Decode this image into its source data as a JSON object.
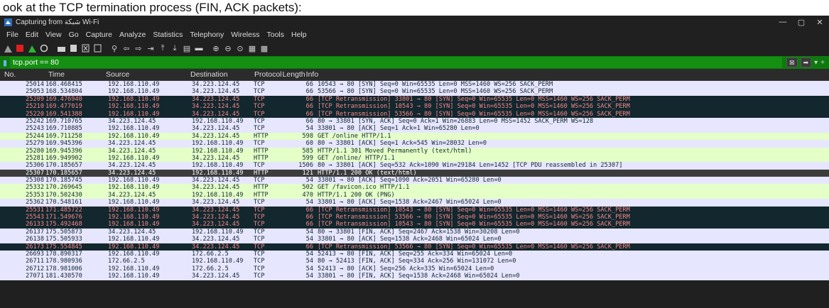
{
  "caption": "ook at the TCP termination process (FIN, ACK packets):",
  "window": {
    "title": "Capturing from شبكة Wi-Fi",
    "minimize": "—",
    "maximize": "▢",
    "close": "✕"
  },
  "menu": [
    "File",
    "Edit",
    "View",
    "Go",
    "Capture",
    "Analyze",
    "Statistics",
    "Telephony",
    "Wireless",
    "Tools",
    "Help"
  ],
  "toolbar_icons": [
    "shark-fin-icon",
    "stop-icon",
    "restart-icon",
    "options-icon",
    "open-icon",
    "save-icon",
    "close-file-icon",
    "reload-icon",
    "find-icon",
    "back-icon",
    "forward-icon",
    "goto-icon",
    "first-icon",
    "last-icon",
    "autoscroll-icon",
    "colorize-icon",
    "zoom-in-icon",
    "zoom-out-icon",
    "normal-size-icon",
    "resize-columns-icon"
  ],
  "filter": {
    "value": "tcp.port == 80"
  },
  "columns": [
    "No.",
    "Time",
    "Source",
    "Destination",
    "Protocol",
    "Length",
    "Info"
  ],
  "colors": {
    "filter_bg": "#0e7a0d",
    "retrans_fg": "#f78787",
    "retrans_bg": "#12272e",
    "http_bg": "#e4ffc7",
    "tcp_bg": "#e7e6ff"
  },
  "packets": [
    {
      "no": "25014",
      "time": "168.468415",
      "src": "192.168.110.49",
      "dst": "34.223.124.45",
      "proto": "TCP",
      "len": "66",
      "info": "10543 → 80 [SYN] Seq=0 Win=65535 Len=0 MSS=1460 WS=256 SACK_PERM",
      "style": "tcpg"
    },
    {
      "no": "25053",
      "time": "168.534804",
      "src": "192.168.110.49",
      "dst": "34.223.124.45",
      "proto": "TCP",
      "len": "66",
      "info": "53566 → 80 [SYN] Seq=0 Win=65535 Len=0 MSS=1460 WS=256 SACK_PERM",
      "style": "tcpg"
    },
    {
      "no": "25209",
      "time": "169.476940",
      "src": "192.168.110.49",
      "dst": "34.223.124.45",
      "proto": "TCP",
      "len": "66",
      "info": "[TCP Retransmission] 33801 → 80 [SYN] Seq=0 Win=65535 Len=0 MSS=1460 WS=256 SACK_PERM",
      "style": "retrans"
    },
    {
      "no": "25210",
      "time": "169.477019",
      "src": "192.168.110.49",
      "dst": "34.223.124.45",
      "proto": "TCP",
      "len": "66",
      "info": "[TCP Retransmission] 10543 → 80 [SYN] Seq=0 Win=65535 Len=0 MSS=1460 WS=256 SACK_PERM",
      "style": "retrans"
    },
    {
      "no": "25220",
      "time": "169.541388",
      "src": "192.168.110.49",
      "dst": "34.223.124.45",
      "proto": "TCP",
      "len": "66",
      "info": "[TCP Retransmission] 53566 → 80 [SYN] Seq=0 Win=65535 Len=0 MSS=1460 WS=256 SACK_PERM",
      "style": "retrans"
    },
    {
      "no": "25242",
      "time": "169.710765",
      "src": "34.223.124.45",
      "dst": "192.168.110.49",
      "proto": "TCP",
      "len": "66",
      "info": "80 → 33801 [SYN, ACK] Seq=0 Ack=1 Win=26883 Len=0 MSS=1452 SACK_PERM WS=128",
      "style": "tcpg"
    },
    {
      "no": "25243",
      "time": "169.710885",
      "src": "192.168.110.49",
      "dst": "34.223.124.45",
      "proto": "TCP",
      "len": "54",
      "info": "33801 → 80 [ACK] Seq=1 Ack=1 Win=65280 Len=0",
      "style": "tcpg"
    },
    {
      "no": "25244",
      "time": "169.711258",
      "src": "192.168.110.49",
      "dst": "34.223.124.45",
      "proto": "HTTP",
      "len": "598",
      "info": "GET /online HTTP/1.1",
      "style": "http"
    },
    {
      "no": "25279",
      "time": "169.945396",
      "src": "34.223.124.45",
      "dst": "192.168.110.49",
      "proto": "TCP",
      "len": "60",
      "info": "80 → 33801 [ACK] Seq=1 Ack=545 Win=28032 Len=0",
      "style": "tcpg"
    },
    {
      "no": "25280",
      "time": "169.945396",
      "src": "34.223.124.45",
      "dst": "192.168.110.49",
      "proto": "HTTP",
      "len": "585",
      "info": "HTTP/1.1 301 Moved Permanently  (text/html)",
      "style": "http"
    },
    {
      "no": "25281",
      "time": "169.949902",
      "src": "192.168.110.49",
      "dst": "34.223.124.45",
      "proto": "HTTP",
      "len": "599",
      "info": "GET /online/ HTTP/1.1",
      "style": "http"
    },
    {
      "no": "25306",
      "time": "170.185657",
      "src": "34.223.124.45",
      "dst": "192.168.110.49",
      "proto": "TCP",
      "len": "1506",
      "info": "80 → 33801 [ACK] Seq=532 Ack=1090 Win=29184 Len=1452 [TCP PDU reassembled in 25307]",
      "style": "tcpg"
    },
    {
      "no": "25307",
      "time": "170.185657",
      "src": "34.223.124.45",
      "dst": "192.168.110.49",
      "proto": "HTTP",
      "len": "121",
      "info": "HTTP/1.1 200 OK  (text/html)",
      "style": "sel"
    },
    {
      "no": "25308",
      "time": "170.185745",
      "src": "192.168.110.49",
      "dst": "34.223.124.45",
      "proto": "TCP",
      "len": "54",
      "info": "33801 → 80 [ACK] Seq=1090 Ack=2051 Win=65280 Len=0",
      "style": "tcpg"
    },
    {
      "no": "25332",
      "time": "170.269645",
      "src": "192.168.110.49",
      "dst": "34.223.124.45",
      "proto": "HTTP",
      "len": "502",
      "info": "GET /favicon.ico HTTP/1.1",
      "style": "http"
    },
    {
      "no": "25353",
      "time": "170.502430",
      "src": "34.223.124.45",
      "dst": "192.168.110.49",
      "proto": "HTTP",
      "len": "470",
      "info": "HTTP/1.1 200 OK  (PNG)",
      "style": "http"
    },
    {
      "no": "25362",
      "time": "170.548161",
      "src": "192.168.110.49",
      "dst": "34.223.124.45",
      "proto": "TCP",
      "len": "54",
      "info": "33801 → 80 [ACK] Seq=1538 Ack=2467 Win=65024 Len=0",
      "style": "tcpg"
    },
    {
      "no": "25531",
      "time": "171.485722",
      "src": "192.168.110.49",
      "dst": "34.223.124.45",
      "proto": "TCP",
      "len": "66",
      "info": "[TCP Retransmission] 10543 → 80 [SYN] Seq=0 Win=65535 Len=0 MSS=1460 WS=256 SACK_PERM",
      "style": "retrans"
    },
    {
      "no": "25543",
      "time": "171.549676",
      "src": "192.168.110.49",
      "dst": "34.223.124.45",
      "proto": "TCP",
      "len": "66",
      "info": "[TCP Retransmission] 53566 → 80 [SYN] Seq=0 Win=65535 Len=0 MSS=1460 WS=256 SACK_PERM",
      "style": "retrans"
    },
    {
      "no": "26133",
      "time": "175.492468",
      "src": "192.168.110.49",
      "dst": "34.223.124.45",
      "proto": "TCP",
      "len": "66",
      "info": "[TCP Retransmission] 10543 → 80 [SYN] Seq=0 Win=65535 Len=0 MSS=1460 WS=256 SACK_PERM",
      "style": "retrans"
    },
    {
      "no": "26137",
      "time": "175.505873",
      "src": "34.223.124.45",
      "dst": "192.168.110.49",
      "proto": "TCP",
      "len": "54",
      "info": "80 → 33801 [FIN, ACK] Seq=2467 Ack=1538 Win=30208 Len=0",
      "style": "tcpg"
    },
    {
      "no": "26138",
      "time": "175.505933",
      "src": "192.168.110.49",
      "dst": "34.223.124.45",
      "proto": "TCP",
      "len": "54",
      "info": "33801 → 80 [ACK] Seq=1538 Ack=2468 Win=65024 Len=0",
      "style": "tcpg"
    },
    {
      "no": "26173",
      "time": "175.554845",
      "src": "192.168.110.49",
      "dst": "34.223.124.45",
      "proto": "TCP",
      "len": "66",
      "info": "[TCP Retransmission] 53566 → 80 [SYN] Seq=0 Win=65535 Len=0 MSS=1460 WS=256 SACK_PERM",
      "style": "retrans"
    },
    {
      "no": "26693",
      "time": "178.890317",
      "src": "192.168.110.49",
      "dst": "172.66.2.5",
      "proto": "TCP",
      "len": "54",
      "info": "52413 → 80 [FIN, ACK] Seq=255 Ack=334 Win=65024 Len=0",
      "style": "tcpg"
    },
    {
      "no": "26711",
      "time": "178.980936",
      "src": "172.66.2.5",
      "dst": "192.168.110.49",
      "proto": "TCP",
      "len": "54",
      "info": "80 → 52413 [FIN, ACK] Seq=334 Ack=256 Win=131072 Len=0",
      "style": "tcpg"
    },
    {
      "no": "26712",
      "time": "178.981006",
      "src": "192.168.110.49",
      "dst": "172.66.2.5",
      "proto": "TCP",
      "len": "54",
      "info": "52413 → 80 [ACK] Seq=256 Ack=335 Win=65024 Len=0",
      "style": "tcpg"
    },
    {
      "no": "27071",
      "time": "181.430570",
      "src": "192.168.110.49",
      "dst": "34.223.124.45",
      "proto": "TCP",
      "len": "54",
      "info": "33801 → 80 [FIN, ACK] Seq=1538 Ack=2468 Win=65024 Len=0",
      "style": "tcpg"
    }
  ]
}
